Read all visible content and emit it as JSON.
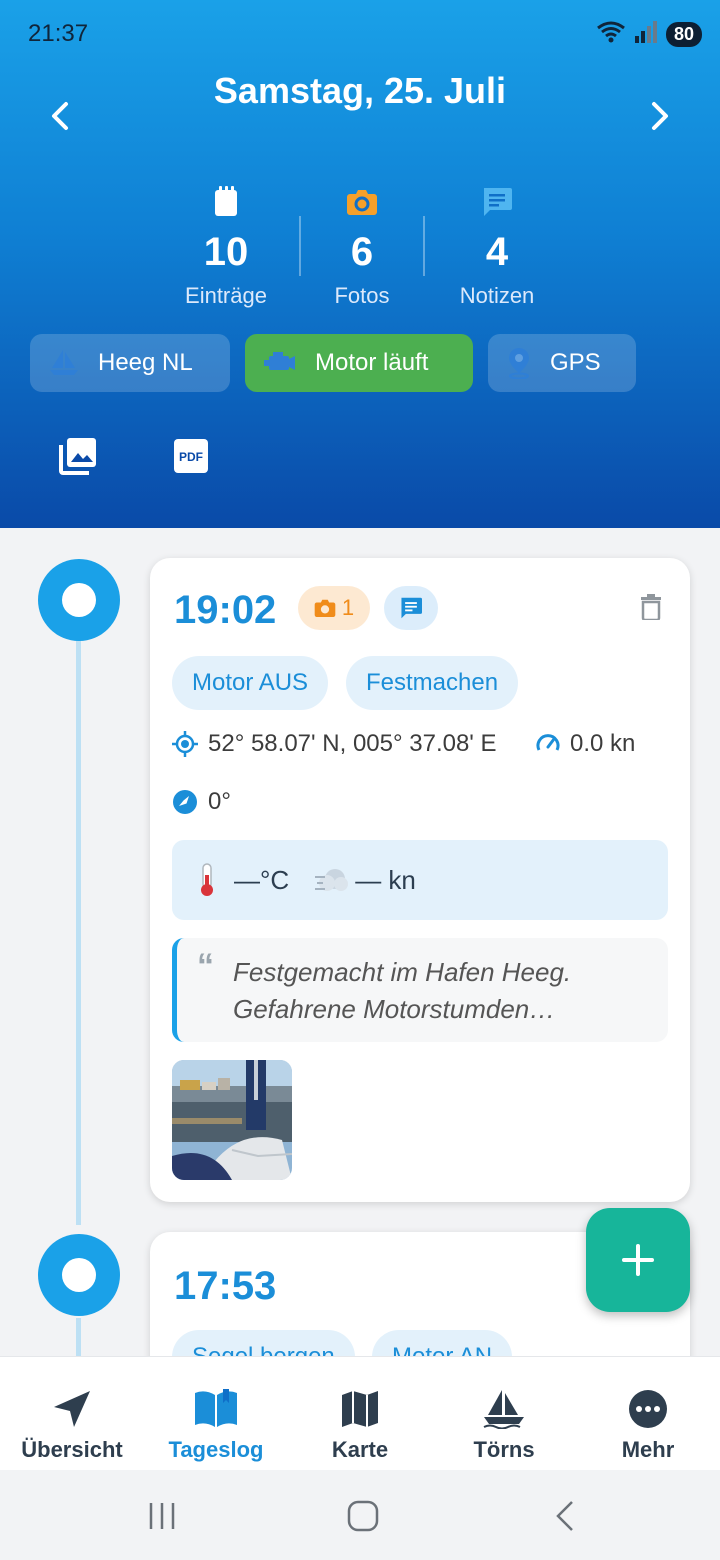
{
  "status_bar": {
    "time": "21:37",
    "battery": "80"
  },
  "header": {
    "date": "Samstag, 25. Juli"
  },
  "stats": [
    {
      "value": "10",
      "label": "Einträge"
    },
    {
      "value": "6",
      "label": "Fotos"
    },
    {
      "value": "4",
      "label": "Notizen"
    }
  ],
  "chips": {
    "location": "Heeg NL",
    "motor": "Motor läuft",
    "gps": "GPS"
  },
  "entries": [
    {
      "time": "19:02",
      "photo_count": "1",
      "tags": [
        "Motor AUS",
        "Festmachen"
      ],
      "position": "52° 58.07' N, 005° 37.08' E",
      "speed": "0.0 kn",
      "heading": "0°",
      "temperature": "—°C",
      "wind": "— kn",
      "note": "Festgemacht im Hafen Heeg. Gefahrene Motorstumden…"
    },
    {
      "time": "17:53",
      "tags": [
        "Segel bergen",
        "Motor AN"
      ]
    }
  ],
  "bottom_nav": [
    {
      "label": "Übersicht",
      "icon": "navigation-arrow-icon"
    },
    {
      "label": "Tageslog",
      "icon": "book-icon"
    },
    {
      "label": "Karte",
      "icon": "map-icon"
    },
    {
      "label": "Törns",
      "icon": "sailboat-icon"
    },
    {
      "label": "Mehr",
      "icon": "more-icon"
    }
  ],
  "colors": {
    "accent": "#1b8ed8",
    "motor_green": "#4caf50",
    "fab": "#17b59a",
    "photo_orange": "#f08c1a"
  }
}
